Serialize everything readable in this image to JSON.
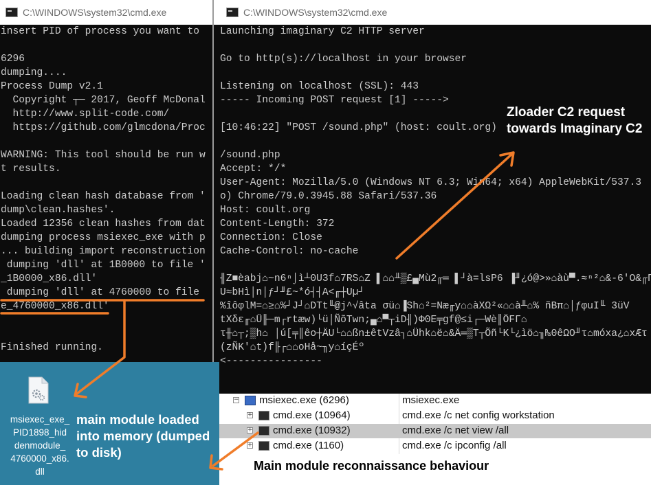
{
  "left_window": {
    "title": "C:\\WINDOWS\\system32\\cmd.exe",
    "lines": [
      "insert PID of process you want to",
      "",
      "6296",
      "dumping....",
      "Process Dump v2.1",
      "  Copyright ┬─ 2017, Geoff McDonal",
      "  http://www.split-code.com/",
      "  https://github.com/glmcdona/Proc",
      "",
      "WARNING: This tool should be run w",
      "t results.",
      "",
      "Loading clean hash database from '",
      "dump\\clean.hashes'.",
      "Loaded 12356 clean hashes from dat",
      "dumping process msiexec_exe with p",
      "... building import reconstruction",
      " dumping 'dll' at 1B0000 to file '",
      "_1B0000_x86.dll'",
      " dumping 'dll' at 4760000 to file",
      "e_4760000_x86.dll'",
      "",
      "",
      "Finished running."
    ]
  },
  "right_window": {
    "title": "C:\\WINDOWS\\system32\\cmd.exe",
    "lines": [
      "Launching imaginary C2 HTTP server",
      "",
      "Go to http(s)://localhost in your browser",
      "",
      "Listening on localhost (SSL): 443",
      "----- Incoming POST request [1] ----->",
      "",
      "[10:46:22] \"POST /sound.php\" (host: coult.org)",
      "",
      "/sound.php",
      "Accept: */*",
      "User-Agent: Mozilla/5.0 (Windows NT 6.3; Win64; x64) AppleWebKit/537.3",
      "o) Chrome/79.0.3945.88 Safari/537.36",
      "Host: coult.org",
      "Content-Length: 372",
      "Connection: Close",
      "Cache-Control: no-cache",
      "",
      "╢Z■èabj⌂~n6ⁿ⌡ì┴0U3f⌂7RS⌂Z ▌⌂⌂╨▒£▄Mù2╓═ ▌┘à=lsP6 ▐╜¿ó@>»⌂àù▀.≈ⁿ²⌂&-6'O&╓Γ",
      "U≈bHì│n│ƒ┘╜£~*ó┤┤A<╓┼Uµ┘",
      "%îôφlM=⌂≥⌂%┘J┘⌂DTt╙@j^√âta σü⌂▐Sh⌂²=Næ╓y⌂⌂àXΩ²«⌂⌂à╨⌂% ñBπ⌂│ƒφuI╙ 3üV",
      "tXδε╓⌂Ü╟─m┌rtæw)└ü│ÑõTwn;▄⌂▀┬iD╢)Φ0E╤gf@≤i┌─Wè║ÖFΓ⌂",
      "τ╫⌂┬;▒h⌂ │ú[╤║êo┼ÄU└⌂⌂ßn±êtVzâ┐⌂Ühk⌂ë⌂&Ä═▒T┬Õñ└K└¿ìö⌂╖₧0êΩO╜τ⌂móxa¿⌂xÆτ",
      "(zÑK'⌂t)f╟┌⌂⌂oHå~╖y⌂íçÉº",
      "<----------------"
    ]
  },
  "annotations": {
    "zloader": "Zloader C2 request towards Imaginary C2",
    "main_module": "main module loaded into memory (dumped to disk)",
    "recon": "Main module reconnaissance behaviour"
  },
  "dumped_file": {
    "name": "msiexec_exe_PID1898_hiddenmodule_4760000_x86.dll",
    "label_lines": [
      "msiexec_exe_",
      "PID1898_hid",
      "denmodule_",
      "4760000_x86.",
      "dll"
    ]
  },
  "process_tree": {
    "rows": [
      {
        "name": "msiexec.exe (6296)",
        "cmd": "msiexec.exe",
        "selected": false
      },
      {
        "name": "cmd.exe (10964)",
        "cmd": "cmd.exe /c net config workstation",
        "selected": false
      },
      {
        "name": "cmd.exe (10932)",
        "cmd": "cmd.exe /c net view /all",
        "selected": true
      },
      {
        "name": "cmd.exe (1160)",
        "cmd": "cmd.exe /c ipconfig /all",
        "selected": false
      }
    ],
    "expander_symbol": "+",
    "collapse_symbol": "−"
  },
  "colors": {
    "console_bg": "#0c0c0c",
    "console_text": "#cccccc",
    "annotation_orange": "#f07d2a",
    "panel_blue": "#2e7fa0"
  },
  "icons": {
    "console_icon": "console-window-icon",
    "file_icon": "dll-file-icon",
    "process_icon": "process-icon"
  }
}
